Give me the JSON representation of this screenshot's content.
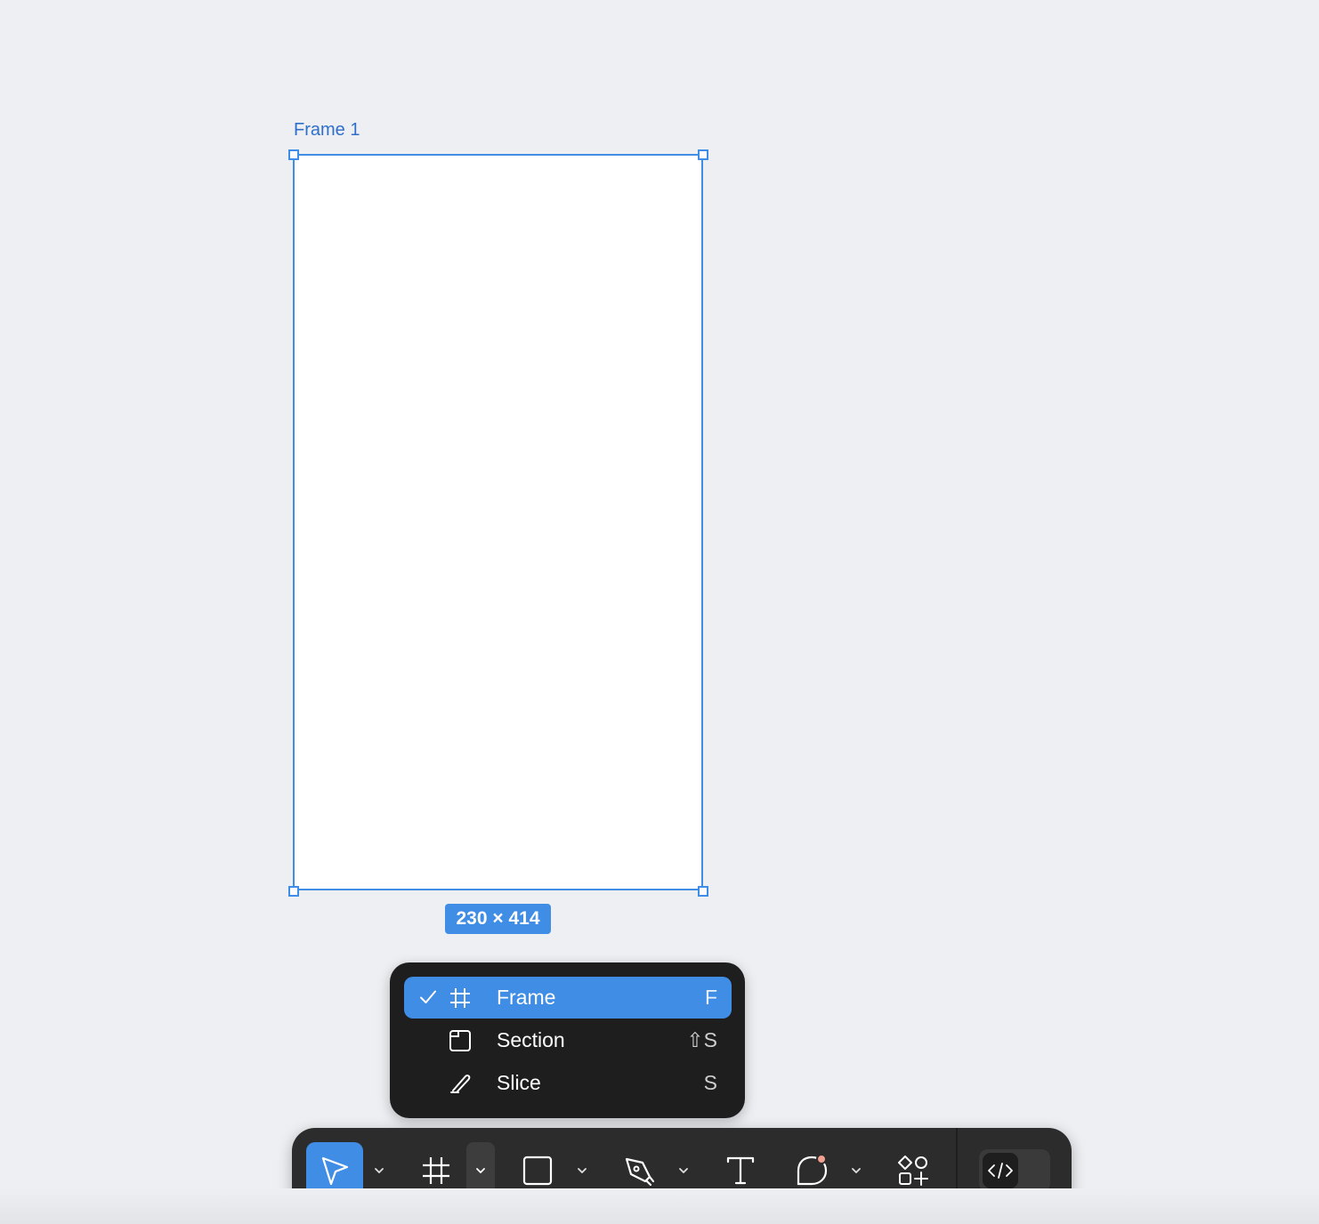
{
  "canvas": {
    "background": "#edeff3",
    "frame": {
      "label": "Frame 1",
      "size_badge": "230 × 414",
      "selection_color": "#3f8de5"
    }
  },
  "frame_menu": {
    "items": [
      {
        "label": "Frame",
        "shortcut": "F",
        "icon": "frame-icon",
        "checked": true
      },
      {
        "label": "Section",
        "shortcut": "⇧S",
        "icon": "section-icon",
        "checked": false
      },
      {
        "label": "Slice",
        "shortcut": "S",
        "icon": "slice-icon",
        "checked": false
      }
    ],
    "active_color": "#3f8de5"
  },
  "toolbar": {
    "tools": [
      {
        "name": "move-tool",
        "icon": "cursor-arrow-icon",
        "active": true
      },
      {
        "name": "frame-tool",
        "icon": "frame-icon",
        "menu_open": true
      },
      {
        "name": "shape-tool",
        "icon": "rectangle-icon"
      },
      {
        "name": "pen-tool",
        "icon": "pen-nib-icon"
      },
      {
        "name": "text-tool",
        "icon": "text-t-icon"
      },
      {
        "name": "comment-tool",
        "icon": "comment-bubble-icon",
        "notification_dot_color": "#f2a08f"
      },
      {
        "name": "actions-tool",
        "icon": "shapes-plus-icon"
      },
      {
        "name": "dev-mode-toggle",
        "icon": "code-brackets-icon"
      }
    ]
  }
}
